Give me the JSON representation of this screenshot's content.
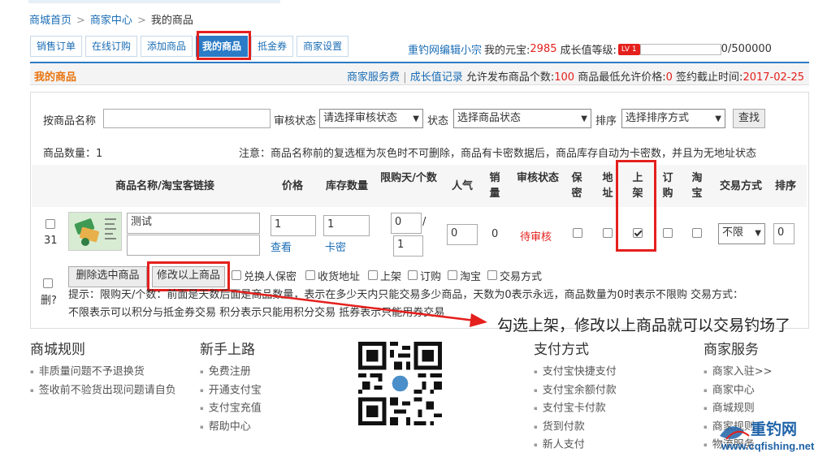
{
  "breadcrumb": {
    "home": "商城首页",
    "center": "商家中心",
    "current": "我的商品",
    "sep": ">"
  },
  "tabs": [
    "销售订单",
    "在线订购",
    "添加商品",
    "我的商品",
    "抵金券",
    "商家设置"
  ],
  "user": {
    "name": "重钓网编辑小宗",
    "yuanbao_label": "我的元宝:",
    "yuanbao_value": "2985",
    "growth_label": "成长值等级:",
    "level": "LV 1",
    "progress_text": "0/500000",
    "progress_fraction": 0
  },
  "header": {
    "title": "我的商品",
    "fee_link": "商家服务费",
    "divider": "|",
    "record_link": "成长值记录",
    "allow_label": "允许发布商品个数:",
    "allow_value": "100",
    "minprice_label": "商品最低允许价格:",
    "minprice_value": "0",
    "deadline_label": "签约截止时间:",
    "deadline_value": "2017-02-25"
  },
  "search": {
    "name_label": "按商品名称",
    "audit_label": "审核状态",
    "audit_value": "请选择审核状态",
    "status_label": "状态",
    "status_value": "选择商品状态",
    "sort_label": "排序",
    "sort_value": "选择排序方式",
    "search_btn": "查找"
  },
  "count_text": "商品数量：1",
  "notice": "注意：商品名称前的复选框为灰色时不可删除，商品有卡密数据后，商品库存自动为卡密数，并且为无地址状态",
  "table": {
    "headers": {
      "name": "商品名称/淘宝客链接",
      "price": "价格",
      "stock": "库存数量",
      "limit": "限购天/个数",
      "popularity": "人气",
      "sales": "销量",
      "audit": "审核状态",
      "secret": "保密",
      "address": "地址",
      "shelf": "上架",
      "order": "订购",
      "taobao": "淘宝",
      "trade": "交易方式",
      "sort": "排序"
    },
    "row": {
      "id": "31",
      "name": "测试",
      "price": "1",
      "view_link": "查看",
      "stock": "1",
      "card_link": "卡密",
      "limit_days": "0",
      "slash": "/",
      "limit_count": "1",
      "popularity": "0",
      "sales": "0",
      "audit": "待审核",
      "trade": "不限",
      "sort": "0"
    }
  },
  "actions": {
    "delete_btn": "删除选中商品",
    "modify_btn": "修改以上商品",
    "options": [
      "兑换人保密",
      "收货地址",
      "上架",
      "订购",
      "淘宝",
      "交易方式"
    ],
    "delete_label": "删?"
  },
  "tip_line1": "提示：限购天/个数：前面是天数后面是商品数量，表示在多少天内只能交易多少商品，天数为0表示永远，商品数量为0时表示不限购 交易方式：",
  "tip_line2": "不限表示可以积分与抵金券交易 积分表示只能用积分交易 抵券表示只能用券交易",
  "annotation": "勾选上架，修改以上商品就可以交易钓场了",
  "footer": [
    {
      "title": "商城规则",
      "items": [
        "非质量问题不予退换货",
        "签收前不验货出现问题请自负"
      ]
    },
    {
      "title": "新手上路",
      "items": [
        "免费注册",
        "开通支付宝",
        "支付宝充值",
        "帮助中心"
      ]
    },
    {
      "title": "支付方式",
      "items": [
        "支付宝快捷支付",
        "支付宝余额付款",
        "支付宝卡付款",
        "货到付款",
        "新人支付"
      ]
    },
    {
      "title": "商家服务",
      "items": [
        "商家入驻>>",
        "商家中心",
        "商城规则",
        "商家规则",
        "物流服务"
      ]
    }
  ],
  "logo": {
    "name": "重钓网",
    "url": "www.cqfishing.net"
  }
}
